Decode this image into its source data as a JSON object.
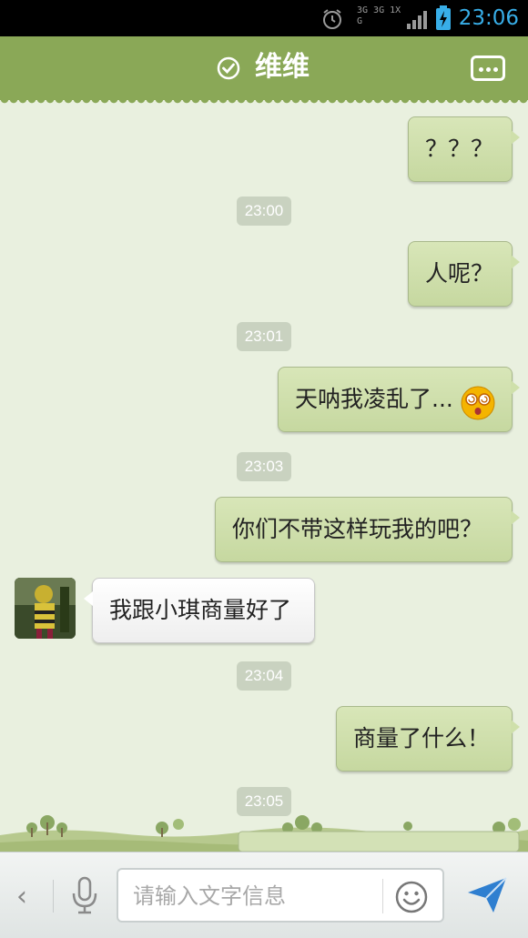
{
  "status_bar": {
    "network_top": "3G 3G 1X G",
    "time": "23:06",
    "icons": [
      "alarm-icon",
      "signal-icon",
      "battery-charging-icon"
    ]
  },
  "header": {
    "title": "维维",
    "icons": [
      "check-circle-icon",
      "more-menu-icon"
    ]
  },
  "messages": [
    {
      "type": "sent",
      "text": "？？？"
    },
    {
      "type": "time",
      "text": "23:00"
    },
    {
      "type": "sent",
      "text": "人呢？"
    },
    {
      "type": "time",
      "text": "23:01"
    },
    {
      "type": "sent",
      "text": "天呐我凌乱了...",
      "emoji": "dizzy-face-emoji"
    },
    {
      "type": "time",
      "text": "23:03"
    },
    {
      "type": "sent",
      "text": "你们不带这样玩我的吧？"
    },
    {
      "type": "received",
      "text": "我跟小琪商量好了"
    },
    {
      "type": "time",
      "text": "23:04"
    },
    {
      "type": "sent",
      "text": "商量了什么！"
    },
    {
      "type": "time",
      "text": "23:05"
    }
  ],
  "input_bar": {
    "placeholder": "请输入文字信息",
    "value": "",
    "icons": [
      "back-chevron-icon",
      "microphone-icon",
      "smiley-icon",
      "send-icon"
    ]
  },
  "colors": {
    "header_green": "#8aa857",
    "sent_bubble": "#cfe0ab",
    "background": "#e9f0df",
    "status_time": "#38aee8",
    "send_icon": "#2f7fd0"
  }
}
